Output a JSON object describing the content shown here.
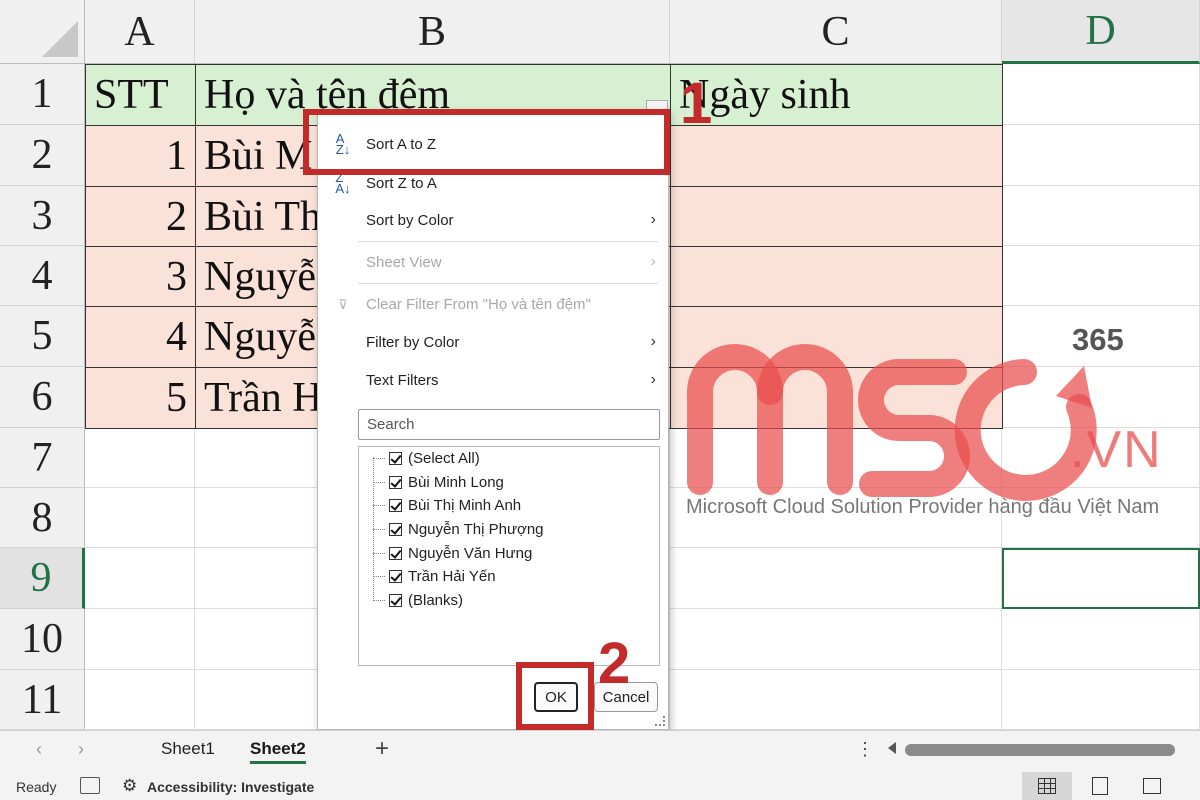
{
  "columns": [
    "A",
    "B",
    "C",
    "D"
  ],
  "rows": [
    "1",
    "2",
    "3",
    "4",
    "5",
    "6",
    "7",
    "8",
    "9",
    "10",
    "11"
  ],
  "table": {
    "headers": [
      "STT",
      "Họ và tên đệm",
      "Ngày sinh"
    ],
    "stt": [
      "1",
      "2",
      "3",
      "4",
      "5"
    ],
    "names": [
      "Bùi M",
      "Bùi Th",
      "Nguyễ",
      "Nguyễ",
      "Trần H"
    ]
  },
  "filter_menu": {
    "sort_az": "Sort A to Z",
    "sort_za": "Sort Z to A",
    "sort_by_color": "Sort by Color",
    "sheet_view": "Sheet View",
    "clear_filter": "Clear Filter From \"Họ và tên đệm\"",
    "filter_by_color": "Filter by Color",
    "text_filters": "Text Filters",
    "search_placeholder": "Search",
    "items": [
      "(Select All)",
      "Bùi Minh Long",
      "Bùi Thị Minh Anh",
      "Nguyễn Thị Phượng",
      "Nguyễn Văn Hưng",
      "Trần Hải Yến",
      "(Blanks)"
    ],
    "ok": "OK",
    "cancel": "Cancel"
  },
  "annotations": {
    "step1": "1",
    "step2": "2"
  },
  "watermark": {
    "badge": "365",
    "suffix": ".VN",
    "tagline": "Microsoft Cloud Solution Provider hàng đầu Việt Nam"
  },
  "sheets": [
    "Sheet1",
    "Sheet2"
  ],
  "active_sheet": "Sheet2",
  "status": {
    "ready": "Ready",
    "accessibility": "Accessibility: Investigate"
  },
  "colors": {
    "header_fill": "#d8f0d2",
    "data_fill": "#fbe2d8",
    "annotation_red": "#c32b2b",
    "excel_green": "#217346",
    "watermark_red": "#e94e4e"
  }
}
